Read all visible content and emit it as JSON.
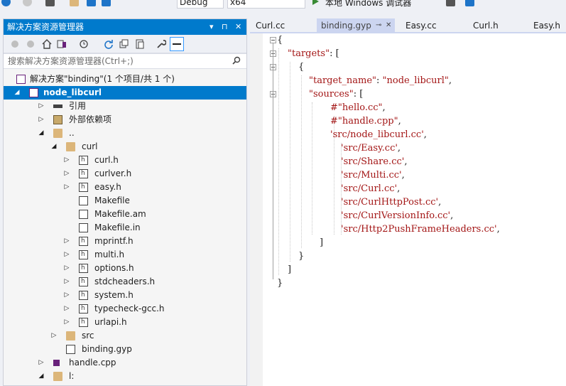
{
  "toolbar": {
    "config": "Debug",
    "platform": "x64",
    "run_label": "本地 Windows 调试器"
  },
  "explorer": {
    "title": "解决方案资源管理器",
    "title_buttons": [
      "▾",
      "⊓",
      "✕"
    ],
    "search_placeholder": "搜索解决方案资源管理器(Ctrl+;)",
    "rows": [
      {
        "label": "解决方案\"binding\"(1 个项目/共 1 个)",
        "level": 0,
        "arrow": "",
        "icon": "solution-icon",
        "selected": false
      },
      {
        "label": "node_libcurl",
        "level": 0,
        "arrow": "◢",
        "icon": "project-icon",
        "selected": true
      },
      {
        "label": "引用",
        "level": 1,
        "arrow": "▷",
        "icon": "references-icon",
        "selected": false
      },
      {
        "label": "外部依赖项",
        "level": 1,
        "arrow": "▷",
        "icon": "external-deps-icon",
        "selected": false
      },
      {
        "label": "..",
        "level": 1,
        "arrow": "◢",
        "icon": "folder-icon",
        "selected": false
      },
      {
        "label": "curl",
        "level": 2,
        "arrow": "◢",
        "icon": "folder-icon",
        "selected": false
      },
      {
        "label": "curl.h",
        "level": 3,
        "arrow": "▷",
        "icon": "header-file-icon",
        "selected": false
      },
      {
        "label": "curlver.h",
        "level": 3,
        "arrow": "▷",
        "icon": "header-file-icon",
        "selected": false
      },
      {
        "label": "easy.h",
        "level": 3,
        "arrow": "▷",
        "icon": "header-file-icon",
        "selected": false
      },
      {
        "label": "Makefile",
        "level": 3,
        "arrow": "",
        "icon": "file-icon",
        "selected": false
      },
      {
        "label": "Makefile.am",
        "level": 3,
        "arrow": "",
        "icon": "file-icon",
        "selected": false
      },
      {
        "label": "Makefile.in",
        "level": 3,
        "arrow": "",
        "icon": "file-icon",
        "selected": false
      },
      {
        "label": "mprintf.h",
        "level": 3,
        "arrow": "▷",
        "icon": "header-file-icon",
        "selected": false
      },
      {
        "label": "multi.h",
        "level": 3,
        "arrow": "▷",
        "icon": "header-file-icon",
        "selected": false
      },
      {
        "label": "options.h",
        "level": 3,
        "arrow": "▷",
        "icon": "header-file-icon",
        "selected": false
      },
      {
        "label": "stdcheaders.h",
        "level": 3,
        "arrow": "▷",
        "icon": "header-file-icon",
        "selected": false
      },
      {
        "label": "system.h",
        "level": 3,
        "arrow": "▷",
        "icon": "header-file-icon",
        "selected": false
      },
      {
        "label": "typecheck-gcc.h",
        "level": 3,
        "arrow": "▷",
        "icon": "header-file-icon",
        "selected": false
      },
      {
        "label": "urlapi.h",
        "level": 3,
        "arrow": "▷",
        "icon": "header-file-icon",
        "selected": false
      },
      {
        "label": "src",
        "level": 2,
        "arrow": "▷",
        "icon": "folder-icon",
        "selected": false
      },
      {
        "label": "binding.gyp",
        "level": 2,
        "arrow": "",
        "icon": "file-icon",
        "selected": false
      },
      {
        "label": "handle.cpp",
        "level": 1,
        "arrow": "▷",
        "icon": "cpp-file-icon",
        "selected": false
      },
      {
        "label": "l:",
        "level": 1,
        "arrow": "◢",
        "icon": "folder-icon",
        "selected": false
      }
    ]
  },
  "tabs": [
    {
      "label": "Curl.cc",
      "active": false
    },
    {
      "label": "binding.gyp",
      "active": true,
      "pin": "⊸",
      "close": "✕"
    },
    {
      "label": "Easy.cc",
      "active": false
    },
    {
      "label": "Curl.h",
      "active": false
    },
    {
      "label": "Easy.h",
      "active": false
    }
  ],
  "code_lines": [
    {
      "indent": 0,
      "text": "{",
      "kind": "pun"
    },
    {
      "indent": 1,
      "text": "\"targets\"",
      "kind": "str",
      "tail": ": ["
    },
    {
      "indent": 2,
      "text": "{",
      "kind": "pun"
    },
    {
      "indent": 3,
      "text": "\"target_name\"",
      "kind": "str",
      "tail": ": ",
      "val": "\"node_libcurl\"",
      "tail2": ","
    },
    {
      "indent": 3,
      "text": "\"sources\"",
      "kind": "str",
      "tail": ": ["
    },
    {
      "indent": 5,
      "text": "#\"hello.cc\"",
      "kind": "str",
      "tail": ","
    },
    {
      "indent": 5,
      "text": "#\"handle.cpp\"",
      "kind": "str",
      "tail": ","
    },
    {
      "indent": 5,
      "text": "'src/node_libcurl.cc'",
      "kind": "str",
      "tail": ","
    },
    {
      "indent": 6,
      "text": "'src/Easy.cc'",
      "kind": "str",
      "tail": ","
    },
    {
      "indent": 6,
      "text": "'src/Share.cc'",
      "kind": "str",
      "tail": ","
    },
    {
      "indent": 6,
      "text": "'src/Multi.cc'",
      "kind": "str",
      "tail": ","
    },
    {
      "indent": 6,
      "text": "'src/Curl.cc'",
      "kind": "str",
      "tail": ","
    },
    {
      "indent": 6,
      "text": "'src/CurlHttpPost.cc'",
      "kind": "str",
      "tail": ","
    },
    {
      "indent": 6,
      "text": "'src/CurlVersionInfo.cc'",
      "kind": "str",
      "tail": ","
    },
    {
      "indent": 6,
      "text": "'src/Http2PushFrameHeaders.cc'",
      "kind": "str",
      "tail": ","
    },
    {
      "indent": 4,
      "text": "]",
      "kind": "pun"
    },
    {
      "indent": 2,
      "text": "}",
      "kind": "pun"
    },
    {
      "indent": 1,
      "text": "]",
      "kind": "pun"
    },
    {
      "indent": 0,
      "text": "}",
      "kind": "pun"
    }
  ]
}
